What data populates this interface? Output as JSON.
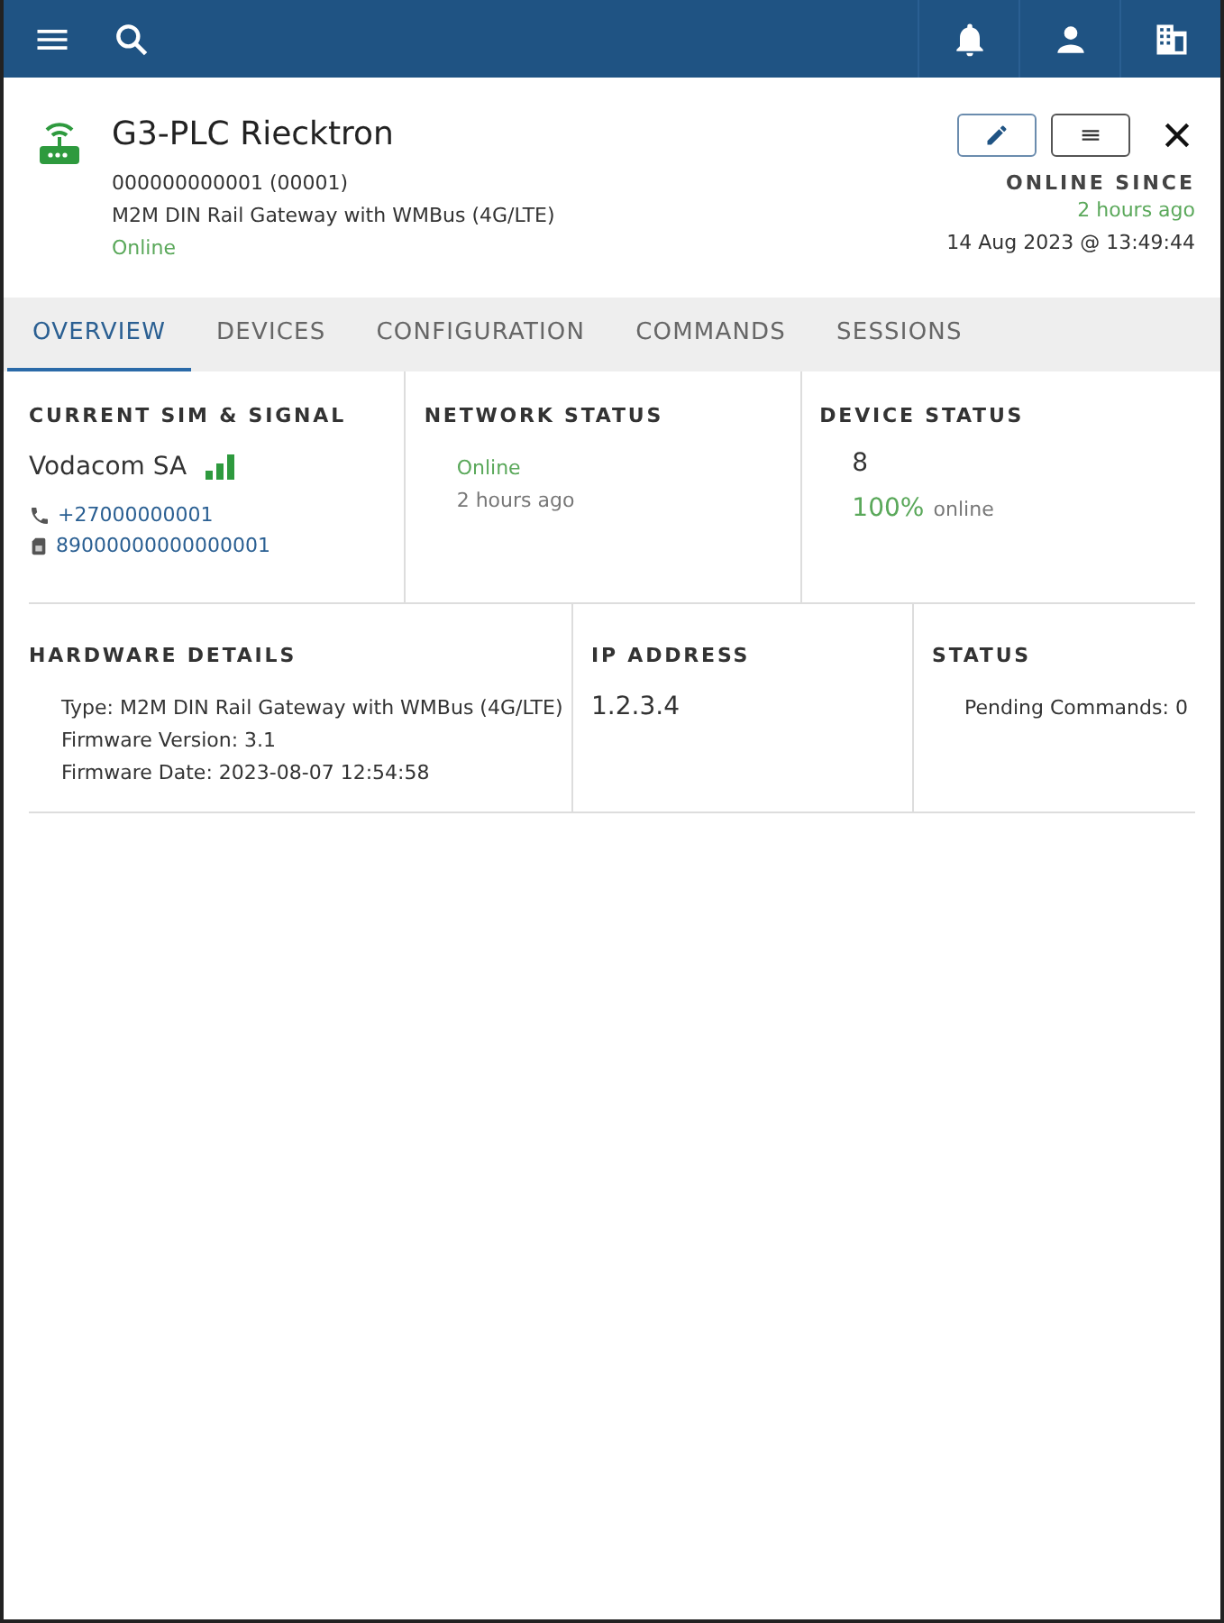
{
  "header": {
    "title": "G3-PLC Riecktron",
    "serial": "000000000001 (00001)",
    "model": "M2M DIN Rail Gateway with WMBus (4G/LTE)",
    "status": "Online",
    "online_since": {
      "label": "ONLINE SINCE",
      "relative": "2 hours ago",
      "date": "14 Aug 2023 @ 13:49:44"
    }
  },
  "tabs": [
    {
      "label": "OVERVIEW",
      "selected": true
    },
    {
      "label": "DEVICES",
      "selected": false
    },
    {
      "label": "CONFIGURATION",
      "selected": false
    },
    {
      "label": "COMMANDS",
      "selected": false
    },
    {
      "label": "SESSIONS",
      "selected": false
    }
  ],
  "sim": {
    "title": "CURRENT SIM & SIGNAL",
    "operator": "Vodacom SA",
    "phone": "+27000000001",
    "iccid": "89000000000000001"
  },
  "network": {
    "title": "NETWORK STATUS",
    "status": "Online",
    "time": "2 hours ago"
  },
  "device_status": {
    "title": "DEVICE STATUS",
    "count": "8",
    "percent": "100%",
    "suffix": "online"
  },
  "hardware": {
    "title": "HARDWARE DETAILS",
    "lines": [
      "Type: M2M DIN Rail Gateway with WMBus (4G/LTE)",
      "Firmware Version: 3.1",
      "Firmware Date: 2023-08-07 12:54:58"
    ]
  },
  "ip": {
    "title": "IP ADDRESS",
    "value": "1.2.3.4"
  },
  "status": {
    "title": "STATUS",
    "lines": [
      "Pending Commands: 0"
    ]
  }
}
